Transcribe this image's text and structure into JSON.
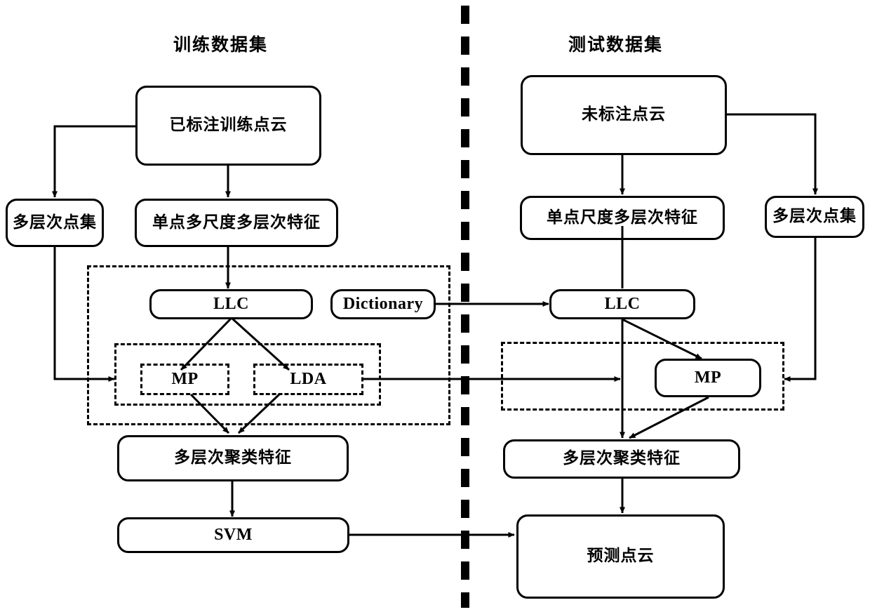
{
  "diagram": {
    "title_left": "训练数据集",
    "title_right": "测试数据集",
    "divider": {
      "style": "dashed-vertical",
      "color": "#000000"
    },
    "colors": {
      "stroke": "#000000",
      "background": "#ffffff"
    }
  },
  "left": {
    "labeled_point_cloud": "已标注训练点云",
    "multilevel_point_set": "多层次点集",
    "single_point_multiscale_feature": "单点多尺度多层次特征",
    "llc": "LLC",
    "dictionary": "Dictionary",
    "mp": "MP",
    "lda": "LDA",
    "multilevel_cluster_feature": "多层次聚类特征",
    "svm": "SVM"
  },
  "right": {
    "unlabeled_point_cloud": "未标注点云",
    "single_point_scale_feature": "单点尺度多层次特征",
    "multilevel_point_set": "多层次点集",
    "llc": "LLC",
    "mp": "MP",
    "multilevel_cluster_feature": "多层次聚类特征",
    "predicted_point_cloud": "预测点云"
  }
}
